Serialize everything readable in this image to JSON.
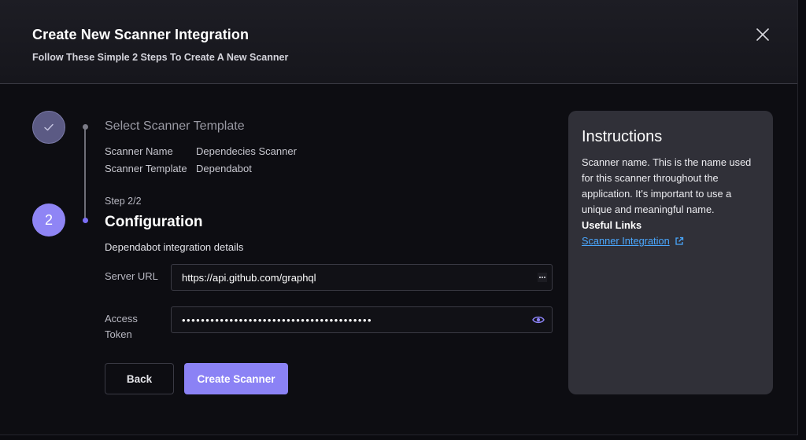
{
  "header": {
    "title": "Create New Scanner Integration",
    "subtitle": "Follow These Simple 2 Steps To Create A New Scanner"
  },
  "stepper": {
    "step1": {
      "title": "Select Scanner Template",
      "summary": [
        {
          "key": "Scanner Name",
          "value": "Dependecies Scanner"
        },
        {
          "key": "Scanner Template",
          "value": "Dependabot"
        }
      ]
    },
    "step2": {
      "number": "2",
      "count": "Step 2/2",
      "title": "Configuration",
      "description": "Dependabot integration details"
    }
  },
  "form": {
    "server_url_label": "Server URL",
    "server_url_value": "https://api.github.com/graphql",
    "access_token_label": "Access Token",
    "access_token_value": "••••••••••••••••••••••••••••••••••••••••"
  },
  "buttons": {
    "back": "Back",
    "create": "Create Scanner"
  },
  "instructions": {
    "title": "Instructions",
    "text": "Scanner name. This is the name used for this scanner throughout the application. It's important to use a unique and meaningful name.",
    "links_title": "Useful Links",
    "link_label": "Scanner Integration"
  },
  "colors": {
    "accent": "#8b82f5",
    "link": "#4aa8ff",
    "panel": "#303038"
  }
}
